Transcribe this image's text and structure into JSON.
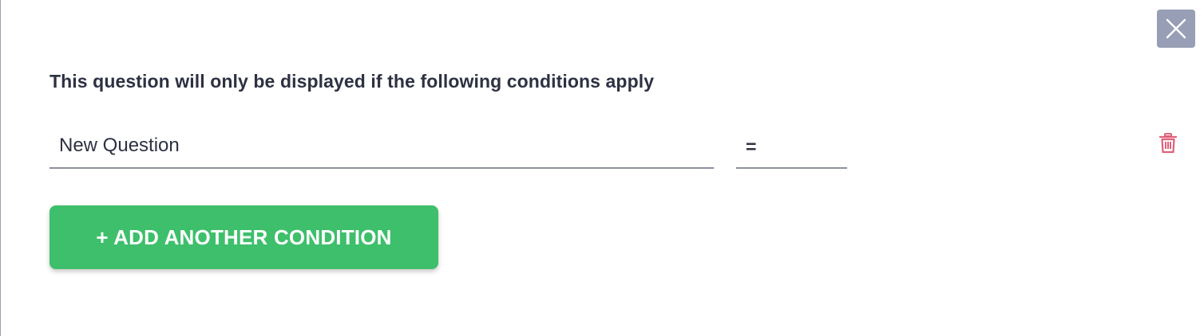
{
  "dialog": {
    "heading": "This question will only be displayed if the following conditions apply",
    "close_icon": "close-icon"
  },
  "condition": {
    "question_value": "New Question",
    "operator_value": "=",
    "delete_icon": "trash-icon"
  },
  "actions": {
    "add_condition_label": "+ ADD ANOTHER CONDITION"
  },
  "colors": {
    "accent_green": "#3dbf6b",
    "close_button_bg": "#979eb5",
    "delete_red": "#e0607a",
    "text_dark": "#2d3142"
  }
}
